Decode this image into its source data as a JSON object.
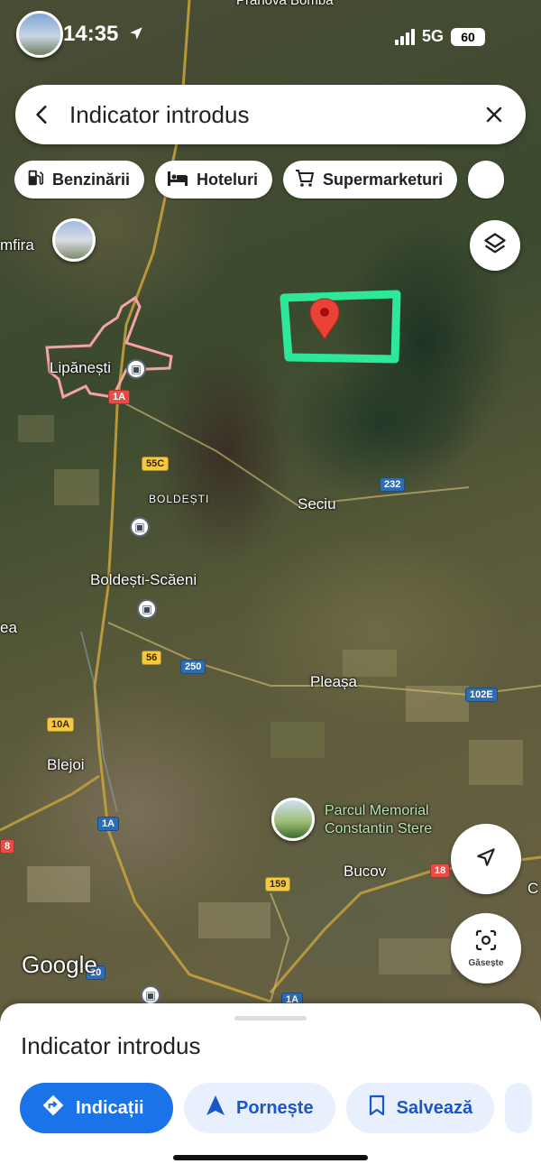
{
  "status_bar": {
    "time": "14:35",
    "network": "5G",
    "battery": "60",
    "location_arrow_icon": "location-arrow-icon"
  },
  "search": {
    "query": "Indicator introdus",
    "back_icon": "back-arrow-icon",
    "clear_icon": "close-icon"
  },
  "chips": [
    {
      "label": "Benzinării",
      "icon": "gas-station-icon"
    },
    {
      "label": "Hoteluri",
      "icon": "hotel-bed-icon"
    },
    {
      "label": "Supermarketuri",
      "icon": "shopping-cart-icon"
    }
  ],
  "map": {
    "places": {
      "lipanesti": "Lipănești",
      "umfira": "mfira",
      "boldesti": "BOLDEȘTI",
      "seciu": "Seciu",
      "boldesti_scaeni": "Boldești-Scăeni",
      "plopeni_partial": "ea",
      "pleasa": "Pleașa",
      "blejoi": "Blejoi",
      "bucov": "Bucov",
      "top_partial": "Prahova Bomba",
      "right_partial": "C"
    },
    "poi": {
      "name_line1": "Parcul Memorial",
      "name_line2": "Constantin Stere"
    },
    "road_shields": [
      {
        "label": "1A",
        "color": "red"
      },
      {
        "label": "55C",
        "color": "yellow"
      },
      {
        "label": "232",
        "color": "blue"
      },
      {
        "label": "56",
        "color": "yellow"
      },
      {
        "label": "250",
        "color": "blue"
      },
      {
        "label": "102E",
        "color": "blue"
      },
      {
        "label": "10A",
        "color": "yellow"
      },
      {
        "label": "1A",
        "color": "blue"
      },
      {
        "label": "8",
        "color": "red"
      },
      {
        "label": "18",
        "color": "red"
      },
      {
        "label": "159",
        "color": "yellow"
      },
      {
        "label": "1A",
        "color": "blue"
      },
      {
        "label": "10",
        "color": "blue"
      }
    ],
    "pin_color": "#ea4335",
    "highlight_color": "#2ee89a",
    "boundary_color": "#f4a3a3",
    "logo": "Google"
  },
  "controls": {
    "layers_icon": "layers-icon",
    "locate_icon": "navigation-arrow-icon",
    "lens_label": "Găsește",
    "lens_icon": "camera-lens-icon"
  },
  "sheet": {
    "title": "Indicator introdus",
    "buttons": [
      {
        "label": "Indicații",
        "icon": "directions-icon"
      },
      {
        "label": "Pornește",
        "icon": "navigation-start-icon"
      },
      {
        "label": "Salvează",
        "icon": "bookmark-icon"
      }
    ]
  },
  "colors": {
    "accent": "#1a73e8",
    "accent_soft": "#e8f0fe",
    "accent_text": "#1a56c8"
  }
}
